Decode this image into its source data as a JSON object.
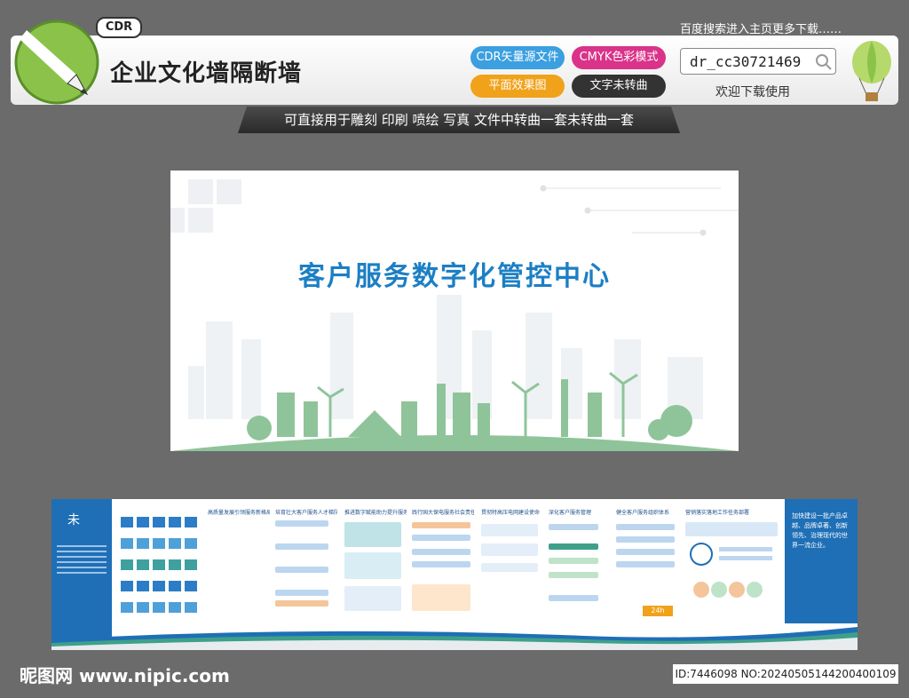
{
  "header": {
    "cdr_tag": "CDR",
    "top_right_text": "百度搜索进入主页更多下载……",
    "title": "企业文化墙隔断墙",
    "pill_cdr": "CDR矢量源文件",
    "pill_cmyk": "CMYK色彩模式",
    "pill_flat": "平面效果图",
    "pill_text": "文字未转曲",
    "search_value": "dr_cc30721469",
    "welcome": "欢迎下载使用",
    "subbar": "可直接用于雕刻 印刷 喷绘 写真  文件中转曲一套未转曲一套"
  },
  "panel": {
    "title": "客户服务数字化管控中心"
  },
  "strip": {
    "columns": [
      "高质量发展引领服务新格局",
      "培育壮大客户服务人才梯队",
      "推进数字赋能助力提升服务质效",
      "践行国大保电服务社会责任",
      "贯彻特高压电网建设使命",
      "深化客户服务管理",
      "健全客户服务组织体系",
      "营销落实落地工作任务部署"
    ],
    "right_text": "加快建设一批产品卓越、品牌卓著、创新领先、治理现代的世界一流企业。",
    "badge": "24h"
  },
  "footer": {
    "site": "昵图网 www.nipic.com",
    "id": "ID:7446098 NO:20240505144200400109"
  },
  "colors": {
    "blue": "#1e6fb6",
    "title_blue": "#1c7fc4",
    "green": "#8fc49a",
    "pill_blue": "#3b9fe0",
    "pill_pink": "#d9338a",
    "pill_orange": "#f0a21a",
    "pill_dark": "#333333"
  }
}
